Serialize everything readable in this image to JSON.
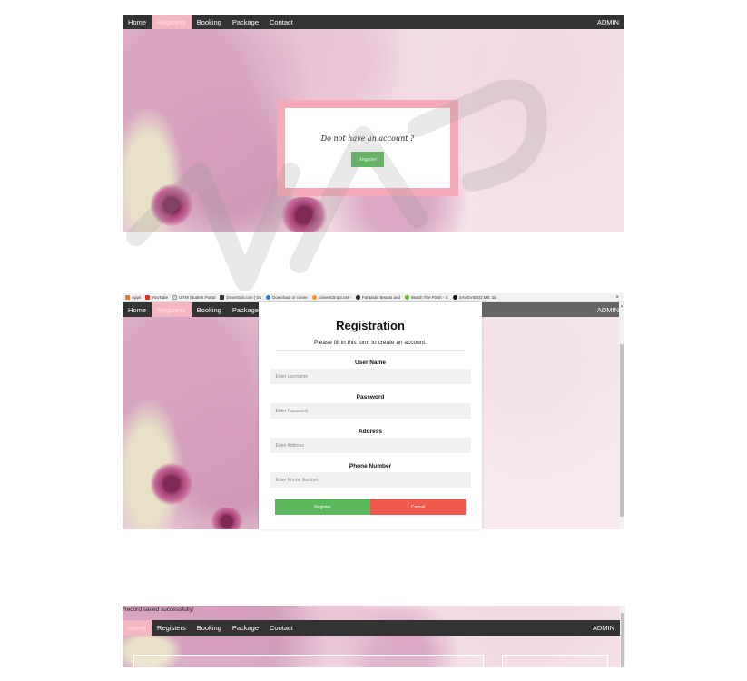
{
  "nav": {
    "items": [
      "Home",
      "Registers",
      "Booking",
      "Package",
      "Contact"
    ],
    "right": "ADMIN"
  },
  "panel1": {
    "question": "Do not have an account ?",
    "register_button": "Register"
  },
  "watermark": "WAPS",
  "panel2": {
    "bookmarks": [
      "Apps",
      "YouTube",
      "UiTM Student Portal",
      "DownSub.com | Do",
      "Download or conve",
      "convert2mp3.net -",
      "Fantastic Beasts and",
      "Watch The Flash - S",
      "SAVEVIDEO.ME: do"
    ],
    "close_symbol": "×",
    "form": {
      "title": "Registration",
      "subtitle": "Please fill in this form to create an account.",
      "fields": [
        {
          "label": "User Name",
          "placeholder": "Enter username"
        },
        {
          "label": "Password",
          "placeholder": "Enter Password"
        },
        {
          "label": "Address",
          "placeholder": "Enter Address"
        },
        {
          "label": "Phone Number",
          "placeholder": "Enter Phone Number"
        }
      ],
      "register_button": "Register",
      "cancel_button": "Cancel"
    }
  },
  "panel3": {
    "saved_message": "Record saved successfully!"
  },
  "colors": {
    "navbar": "#333333",
    "active_tab": "#f4b6c2",
    "green": "#5cb85c",
    "red": "#f05a4e",
    "frame_pink": "#f6a9b8"
  }
}
